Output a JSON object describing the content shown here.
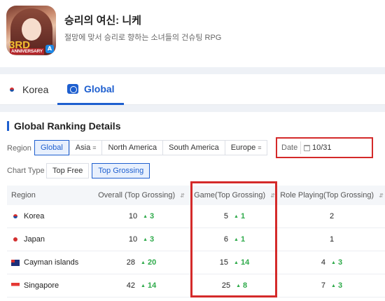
{
  "app": {
    "title": "승리의 여신: 니케",
    "subtitle": "절망에 맞서 승리로 향하는 소녀들의 건슈팅 RPG",
    "icon_badge_number": "3RD",
    "icon_badge_text": "ANNIVERSARY"
  },
  "tabs": [
    {
      "label": "Korea",
      "icon": "korea-flag-icon",
      "active": false
    },
    {
      "label": "Global",
      "icon": "globe-icon",
      "active": true
    }
  ],
  "section": {
    "title": "Global Ranking Details"
  },
  "filters": {
    "region_label": "Region",
    "regions": [
      "Global",
      "Asia",
      "North America",
      "South America",
      "Europe"
    ],
    "selected_region": "Global",
    "date_label": "Date",
    "date_value": "10/31",
    "chart_type_label": "Chart Type",
    "chart_types": [
      "Top Free",
      "Top Grossing"
    ],
    "selected_chart_type": "Top Grossing"
  },
  "table": {
    "columns": [
      "Region",
      "Overall (Top Grossing)",
      "Game(Top Grossing)",
      "Role Playing(Top Grossing)"
    ],
    "rows": [
      {
        "region": "Korea",
        "flag": "korea-flag",
        "overall": "10",
        "overall_change": "3",
        "game": "5",
        "game_change": "1",
        "rpg": "2",
        "rpg_change": ""
      },
      {
        "region": "Japan",
        "flag": "japan-flag",
        "overall": "10",
        "overall_change": "3",
        "game": "6",
        "game_change": "1",
        "rpg": "1",
        "rpg_change": ""
      },
      {
        "region": "Cayman islands",
        "flag": "cayman-flag",
        "overall": "28",
        "overall_change": "20",
        "game": "15",
        "game_change": "14",
        "rpg": "4",
        "rpg_change": "3"
      },
      {
        "region": "Singapore",
        "flag": "singapore-flag",
        "overall": "42",
        "overall_change": "14",
        "game": "25",
        "game_change": "8",
        "rpg": "7",
        "rpg_change": "3"
      }
    ]
  },
  "colors": {
    "accent": "#1e5fcf",
    "up": "#2eaa4a",
    "highlight": "#d42a2a"
  }
}
